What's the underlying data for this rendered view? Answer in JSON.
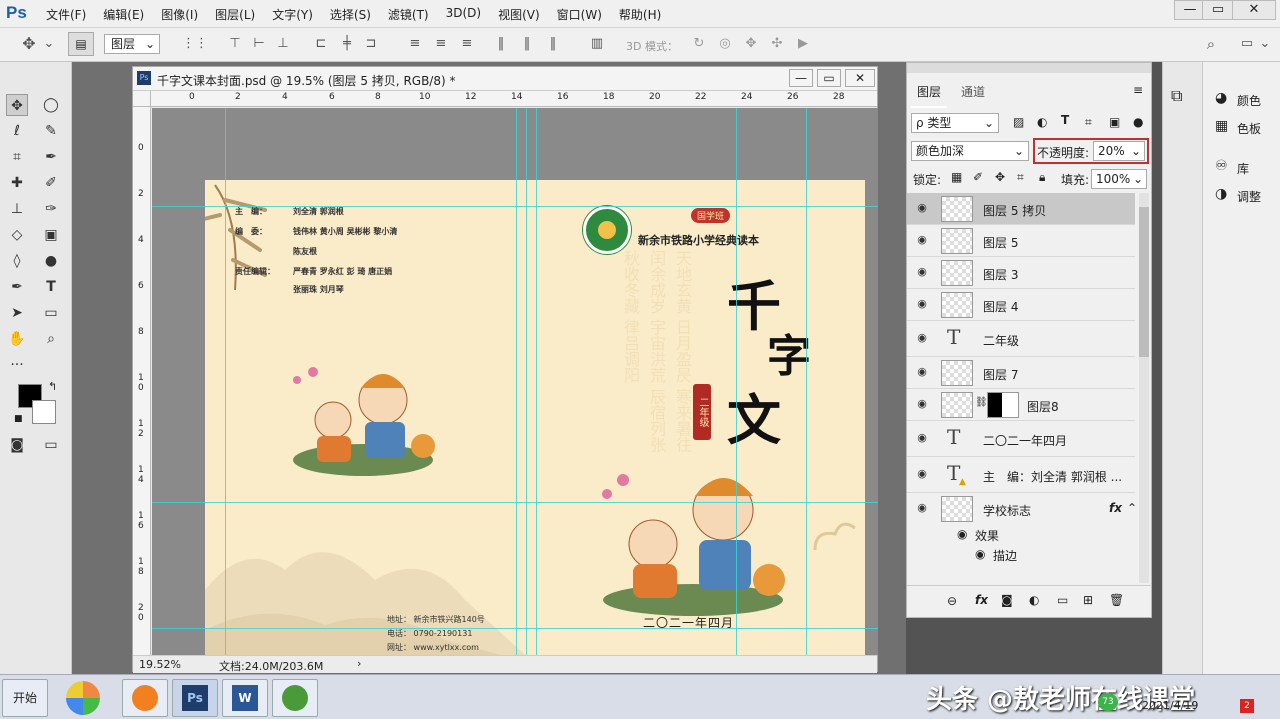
{
  "app": {
    "logo": "Ps"
  },
  "menu": [
    "文件(F)",
    "编辑(E)",
    "图像(I)",
    "图层(L)",
    "文字(Y)",
    "选择(S)",
    "滤镜(T)",
    "3D(D)",
    "视图(V)",
    "窗口(W)",
    "帮助(H)"
  ],
  "window_controls": {
    "minimize": "—",
    "restore": "▭",
    "close": "✕"
  },
  "options": {
    "layer_select": "图层",
    "mode3d": "3D 模式："
  },
  "document": {
    "title": "千字文课本封面.psd @ 19.5% (图层 5 拷贝, RGB/8) *",
    "zoom": "19.52%",
    "docsize": "文档:24.0M/203.6M",
    "ruler_h": [
      "0",
      "2",
      "4",
      "6",
      "8",
      "10",
      "12",
      "14",
      "16",
      "18",
      "20",
      "22",
      "24",
      "26",
      "28"
    ],
    "ruler_v": [
      "0",
      "2",
      "4",
      "6",
      "8",
      "10",
      "12",
      "14",
      "16",
      "18",
      "20"
    ]
  },
  "cover": {
    "credit_chief_label": "主　编：",
    "credit_chief": "刘全清  郭润根",
    "credit_editor_label": "编　委：",
    "credit_editor1": "钱伟林  黄小周  吴彬彬  黎小清",
    "credit_editor2": "陈友根",
    "credit_resp_label": "责任编辑：",
    "credit_resp1": "严春青  罗永红  彭  琦  唐正娟",
    "credit_resp2": "张丽珠  刘月琴",
    "address": "地址：  新余市铁兴路140号",
    "phone": "电话：  0790-2190131",
    "website": "网址：  www.xytlxx.com",
    "badge": "国学班",
    "school_title": "新余市铁路小学经典读本",
    "main_title": [
      "千",
      "字",
      "文"
    ],
    "grade": "二年级",
    "date": "二〇二一年四月",
    "bg_poem": [
      "天地玄黄",
      "日月盈昃",
      "寒来暑往",
      "闰余成岁",
      "宇宙洪荒",
      "辰宿列张",
      "秋收冬藏",
      "律吕调阳"
    ]
  },
  "layers_panel": {
    "tabs": [
      "图层",
      "通道"
    ],
    "filter": "ρ 类型",
    "blend_mode": "颜色加深",
    "opacity_label": "不透明度:",
    "opacity_value": "20%",
    "lock_label": "锁定:",
    "fill_label": "填充:",
    "fill_value": "100%",
    "layers": [
      {
        "name": "图层 5 拷贝",
        "kind": "pixel",
        "selected": true
      },
      {
        "name": "图层 5",
        "kind": "pixel"
      },
      {
        "name": "图层 3",
        "kind": "pixel"
      },
      {
        "name": "图层 4",
        "kind": "pixel"
      },
      {
        "name": "二年级",
        "kind": "text"
      },
      {
        "name": "图层 7",
        "kind": "pixel"
      },
      {
        "name": "图层8",
        "kind": "masked"
      },
      {
        "name": "二〇二一年四月",
        "kind": "text"
      },
      {
        "name": "主　编：刘全清 郭润根 ...",
        "kind": "text-warn"
      },
      {
        "name": "学校标志",
        "kind": "pixel-fx",
        "fx": "fx"
      }
    ],
    "effects_label": "效果",
    "stroke_label": "描边"
  },
  "right_dock": [
    {
      "label": "颜色",
      "icon": "palette-icon"
    },
    {
      "label": "色板",
      "icon": "swatches-icon"
    },
    {
      "label": "库",
      "icon": "library-icon"
    },
    {
      "label": "调整",
      "icon": "adjustments-icon"
    }
  ],
  "taskbar": {
    "start": "开始",
    "watermark": "头条 @敖老师在线课堂",
    "date": "2021/4/19",
    "badge_count": "73",
    "notif": "2"
  },
  "colors": {
    "accent_guide": "#3ad4d8",
    "cover_bg": "#fbecc9",
    "highlight_border": "#c03030"
  }
}
